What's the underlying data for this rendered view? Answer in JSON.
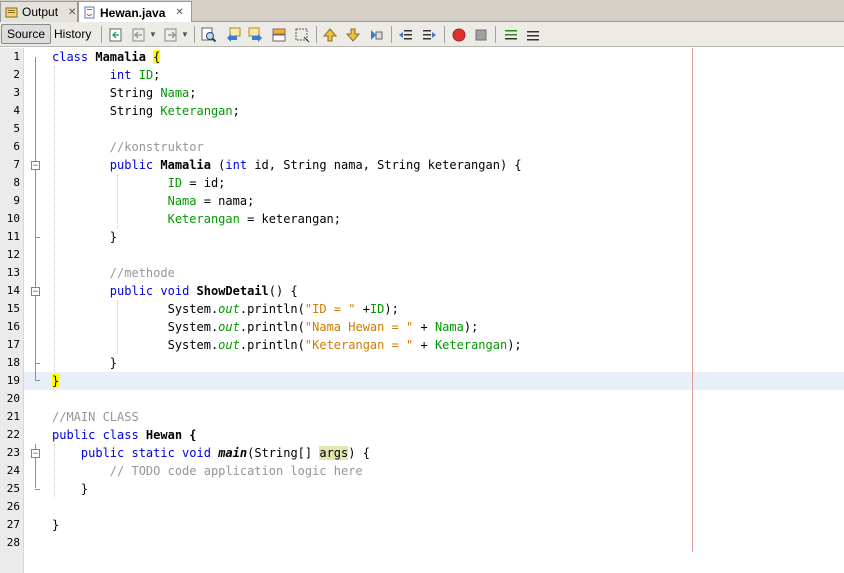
{
  "tabs": [
    {
      "label": "Output",
      "active": false
    },
    {
      "label": "Hewan.java",
      "active": true
    }
  ],
  "toolbar": {
    "source_label": "Source",
    "history_label": "History"
  },
  "editor": {
    "line_numbers": [
      "1",
      "2",
      "3",
      "4",
      "5",
      "6",
      "7",
      "8",
      "9",
      "10",
      "11",
      "12",
      "13",
      "14",
      "15",
      "16",
      "17",
      "18",
      "19",
      "20",
      "21",
      "22",
      "23",
      "24",
      "25",
      "26",
      "27",
      "28"
    ],
    "current_line": "19"
  },
  "code": {
    "l1_kw": "class",
    "l1_name": " Mamalia ",
    "l1_brace": "{",
    "l2_indent": "        ",
    "l2_type": "int",
    "l2_field": "ID",
    "l2_end": ";",
    "l3_type": "        String ",
    "l3_field": "Nama",
    "l3_end": ";",
    "l4_type": "        String ",
    "l4_field": "Keterangan",
    "l4_end": ";",
    "l6_comment": "        //konstruktor",
    "l7_kw1": "public",
    "l7_name": " Mamalia",
    "l7_open": " (",
    "l7_kw2": "int",
    "l7_rest": " id, String nama, String keterangan) {",
    "l8_field": "ID",
    "l8_rest": " = id;",
    "l9_field": "Nama",
    "l9_rest": " = nama;",
    "l10_field": "Keterangan",
    "l10_rest": " = keterangan;",
    "l11": "        }",
    "l13_comment": "        //methode",
    "l14_kw1": "public",
    "l14_kw2": "void",
    "l14_name": "ShowDetail",
    "l14_rest": "() {",
    "sys": "System.",
    "out": "out",
    "println": ".println(",
    "l15_str": "\"ID = \"",
    "l15_plus": " +",
    "l15_field": "ID",
    "l15_end": ");",
    "l16_str": "\"Nama Hewan = \"",
    "l16_plus": " + ",
    "l16_field": "Nama",
    "l16_end": ");",
    "l17_str": "\"Keterangan = \"",
    "l17_plus": " + ",
    "l17_field": "Keterangan",
    "l17_end": ");",
    "l18": "        }",
    "l19_brace": "}",
    "l21_comment": "//MAIN CLASS",
    "l22_kw": "public class",
    "l22_rest": " Hewan {",
    "l23_kw": "public static void",
    "l23_name": "main",
    "l23_mid": "(String[] ",
    "l23_arg": "args",
    "l23_end": ") {",
    "l24_comment": "// TODO code application logic here",
    "l25": "    }",
    "l27": "}"
  }
}
